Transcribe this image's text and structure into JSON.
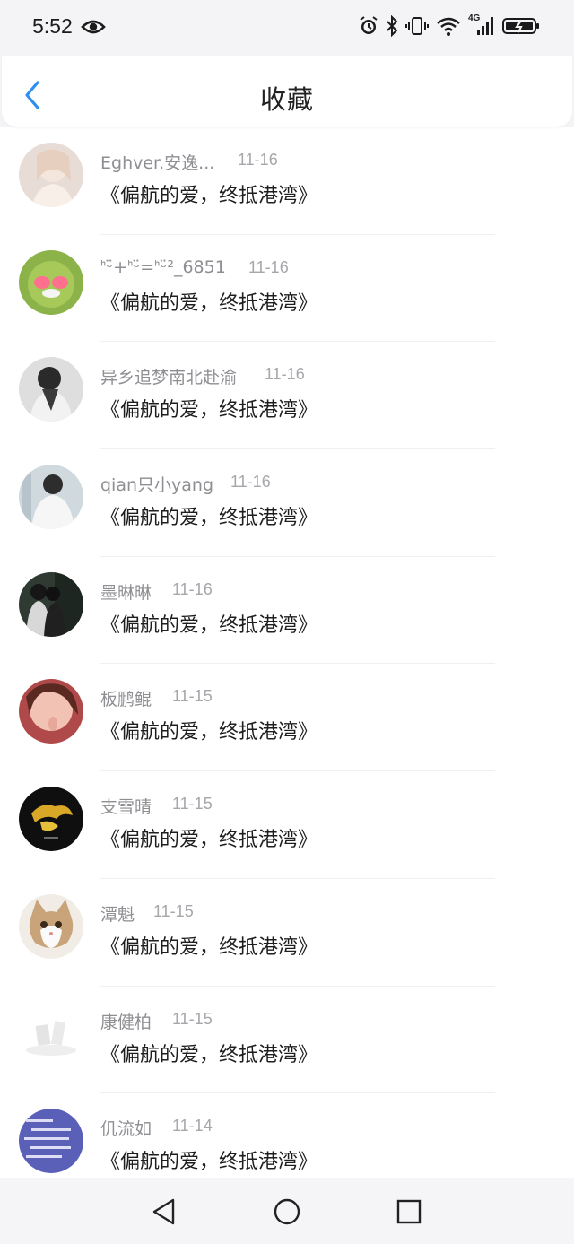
{
  "status_bar": {
    "time": "5:52",
    "network_label": "4G"
  },
  "header": {
    "title": "收藏"
  },
  "items": [
    {
      "name": "Eghver.安逸...",
      "date": "11-16",
      "title": "《偏航的爱，终抵港湾》"
    },
    {
      "name": "ᑋᵕ̈+ᑋᵕ̈=ᑋᵕ̈²_6851",
      "date": "11-16",
      "title": "《偏航的爱，终抵港湾》"
    },
    {
      "name": "异乡追梦南北赴渝",
      "date": "11-16",
      "title": "《偏航的爱，终抵港湾》"
    },
    {
      "name": "qian只小yang",
      "date": "11-16",
      "title": "《偏航的爱，终抵港湾》"
    },
    {
      "name": "墨晽晽",
      "date": "11-16",
      "title": "《偏航的爱，终抵港湾》"
    },
    {
      "name": "板鹏鲲",
      "date": "11-15",
      "title": "《偏航的爱，终抵港湾》"
    },
    {
      "name": "支雪晴",
      "date": "11-15",
      "title": "《偏航的爱，终抵港湾》"
    },
    {
      "name": "潭魁",
      "date": "11-15",
      "title": "《偏航的爱，终抵港湾》"
    },
    {
      "name": "康健柏",
      "date": "11-15",
      "title": "《偏航的爱，终抵港湾》"
    },
    {
      "name": "仉流如",
      "date": "11-14",
      "title": "《偏航的爱，终抵港湾》"
    }
  ],
  "colors": {
    "accent": "#2f8ff0",
    "title_text": "#222222",
    "meta_text": "#8e8e93"
  }
}
